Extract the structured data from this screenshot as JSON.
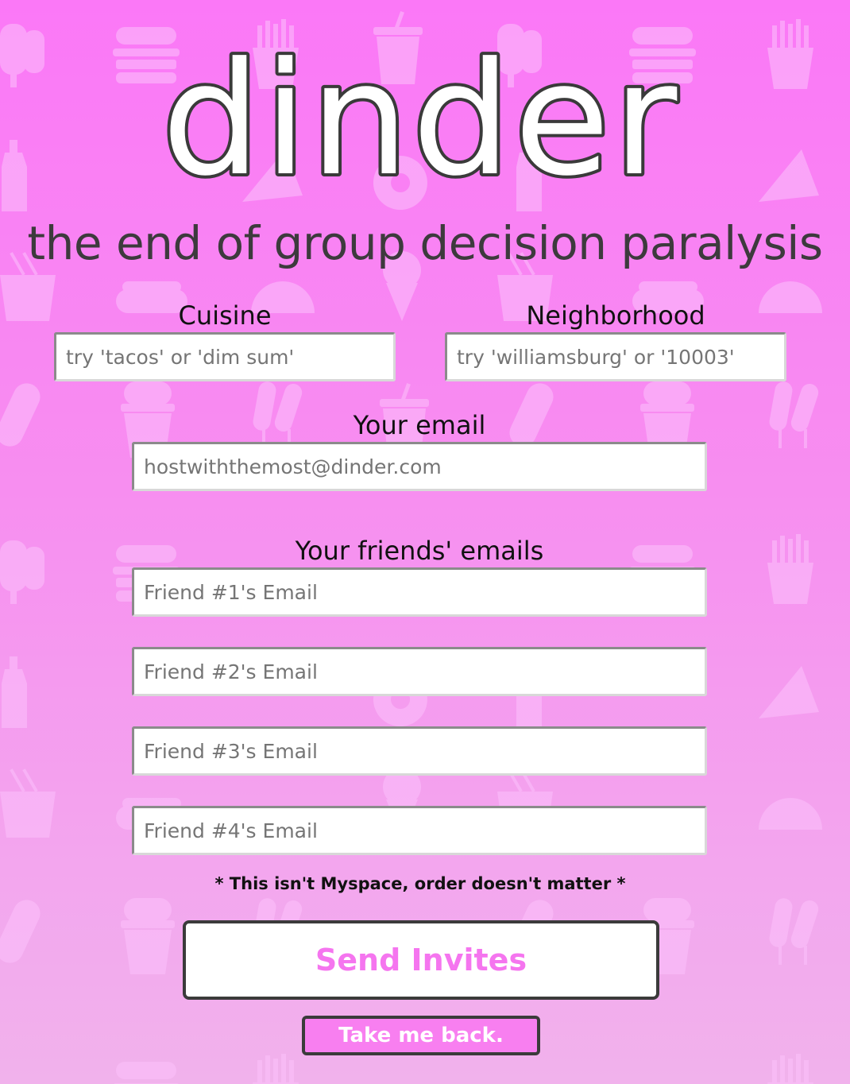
{
  "brand": {
    "logo_text": "dinder",
    "tagline": "the end of group decision paralysis"
  },
  "form": {
    "cuisine": {
      "label": "Cuisine",
      "placeholder": "try 'tacos' or 'dim sum'",
      "value": ""
    },
    "neighborhood": {
      "label": "Neighborhood",
      "placeholder": "try 'williamsburg' or '10003'",
      "value": ""
    },
    "your_email": {
      "label": "Your email",
      "placeholder": "hostwiththemost@dinder.com",
      "value": ""
    },
    "friends": {
      "label": "Your friends' emails",
      "fields": [
        {
          "placeholder": "Friend #1's Email",
          "value": ""
        },
        {
          "placeholder": "Friend #2's Email",
          "value": ""
        },
        {
          "placeholder": "Friend #3's Email",
          "value": ""
        },
        {
          "placeholder": "Friend #4's Email",
          "value": ""
        }
      ]
    },
    "note": "* This isn't Myspace, order doesn't matter *"
  },
  "actions": {
    "send_label": "Send Invites",
    "back_label": "Take me back."
  },
  "colors": {
    "accent": "#f575ef",
    "background_top": "#fb78f7",
    "background_bottom": "#f1b2ec",
    "border_dark": "#3b3b3b"
  },
  "icons": [
    "burger-icon",
    "fries-icon",
    "popsicle-icon",
    "soda-cup-icon",
    "pizza-slice-icon",
    "donut-icon",
    "taco-icon",
    "hot-dog-icon",
    "ice-cream-cone-icon",
    "noodle-box-icon",
    "burrito-icon",
    "corn-dog-icon",
    "milkshake-icon",
    "ketchup-bottle-icon"
  ]
}
